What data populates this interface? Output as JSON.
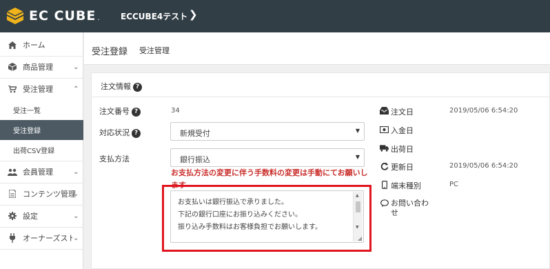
{
  "brand": {
    "logo_text": "EC CUBE",
    "logo_dot": "."
  },
  "header": {
    "shop_name": "ECCUBE4テスト",
    "chevron": "❯"
  },
  "sidebar": {
    "items": [
      {
        "label": "ホーム",
        "icon": "home-icon"
      },
      {
        "label": "商品管理",
        "icon": "cube-icon"
      },
      {
        "label": "受注管理",
        "icon": "cart-icon"
      },
      {
        "label": "会員管理",
        "icon": "users-icon"
      },
      {
        "label": "コンテンツ管理",
        "icon": "file-icon"
      },
      {
        "label": "設定",
        "icon": "gear-icon"
      },
      {
        "label": "オーナーズストア",
        "icon": "plug-icon"
      }
    ],
    "sub_items": [
      {
        "label": "受注一覧"
      },
      {
        "label": "受注登録"
      },
      {
        "label": "出荷CSV登録"
      }
    ]
  },
  "page": {
    "title": "受注登録",
    "subtitle": "受注管理"
  },
  "order": {
    "section_title": "注文情報",
    "order_no_label": "注文番号",
    "order_no": "34",
    "status_label": "対応状況",
    "status_value": "新規受付",
    "payment_label": "支払方法",
    "payment_value": "銀行振込",
    "warning": "お支払方法の変更に伴う手数料の変更は手動にてお願いします",
    "message_lines": [
      "お支払いは銀行振込で承りました。",
      "下記の銀行口座にお振り込みください。",
      "振り込み手数料はお客様負担でお願いします。"
    ]
  },
  "meta": {
    "order_date_label": "注文日",
    "order_date": "2019/05/06 6:54:20",
    "payment_date_label": "入金日",
    "ship_date_label": "出荷日",
    "update_date_label": "更新日",
    "update_date": "2019/05/06 6:54:20",
    "device_label": "端末種別",
    "device": "PC",
    "contact_label": "お問い合わせ"
  }
}
